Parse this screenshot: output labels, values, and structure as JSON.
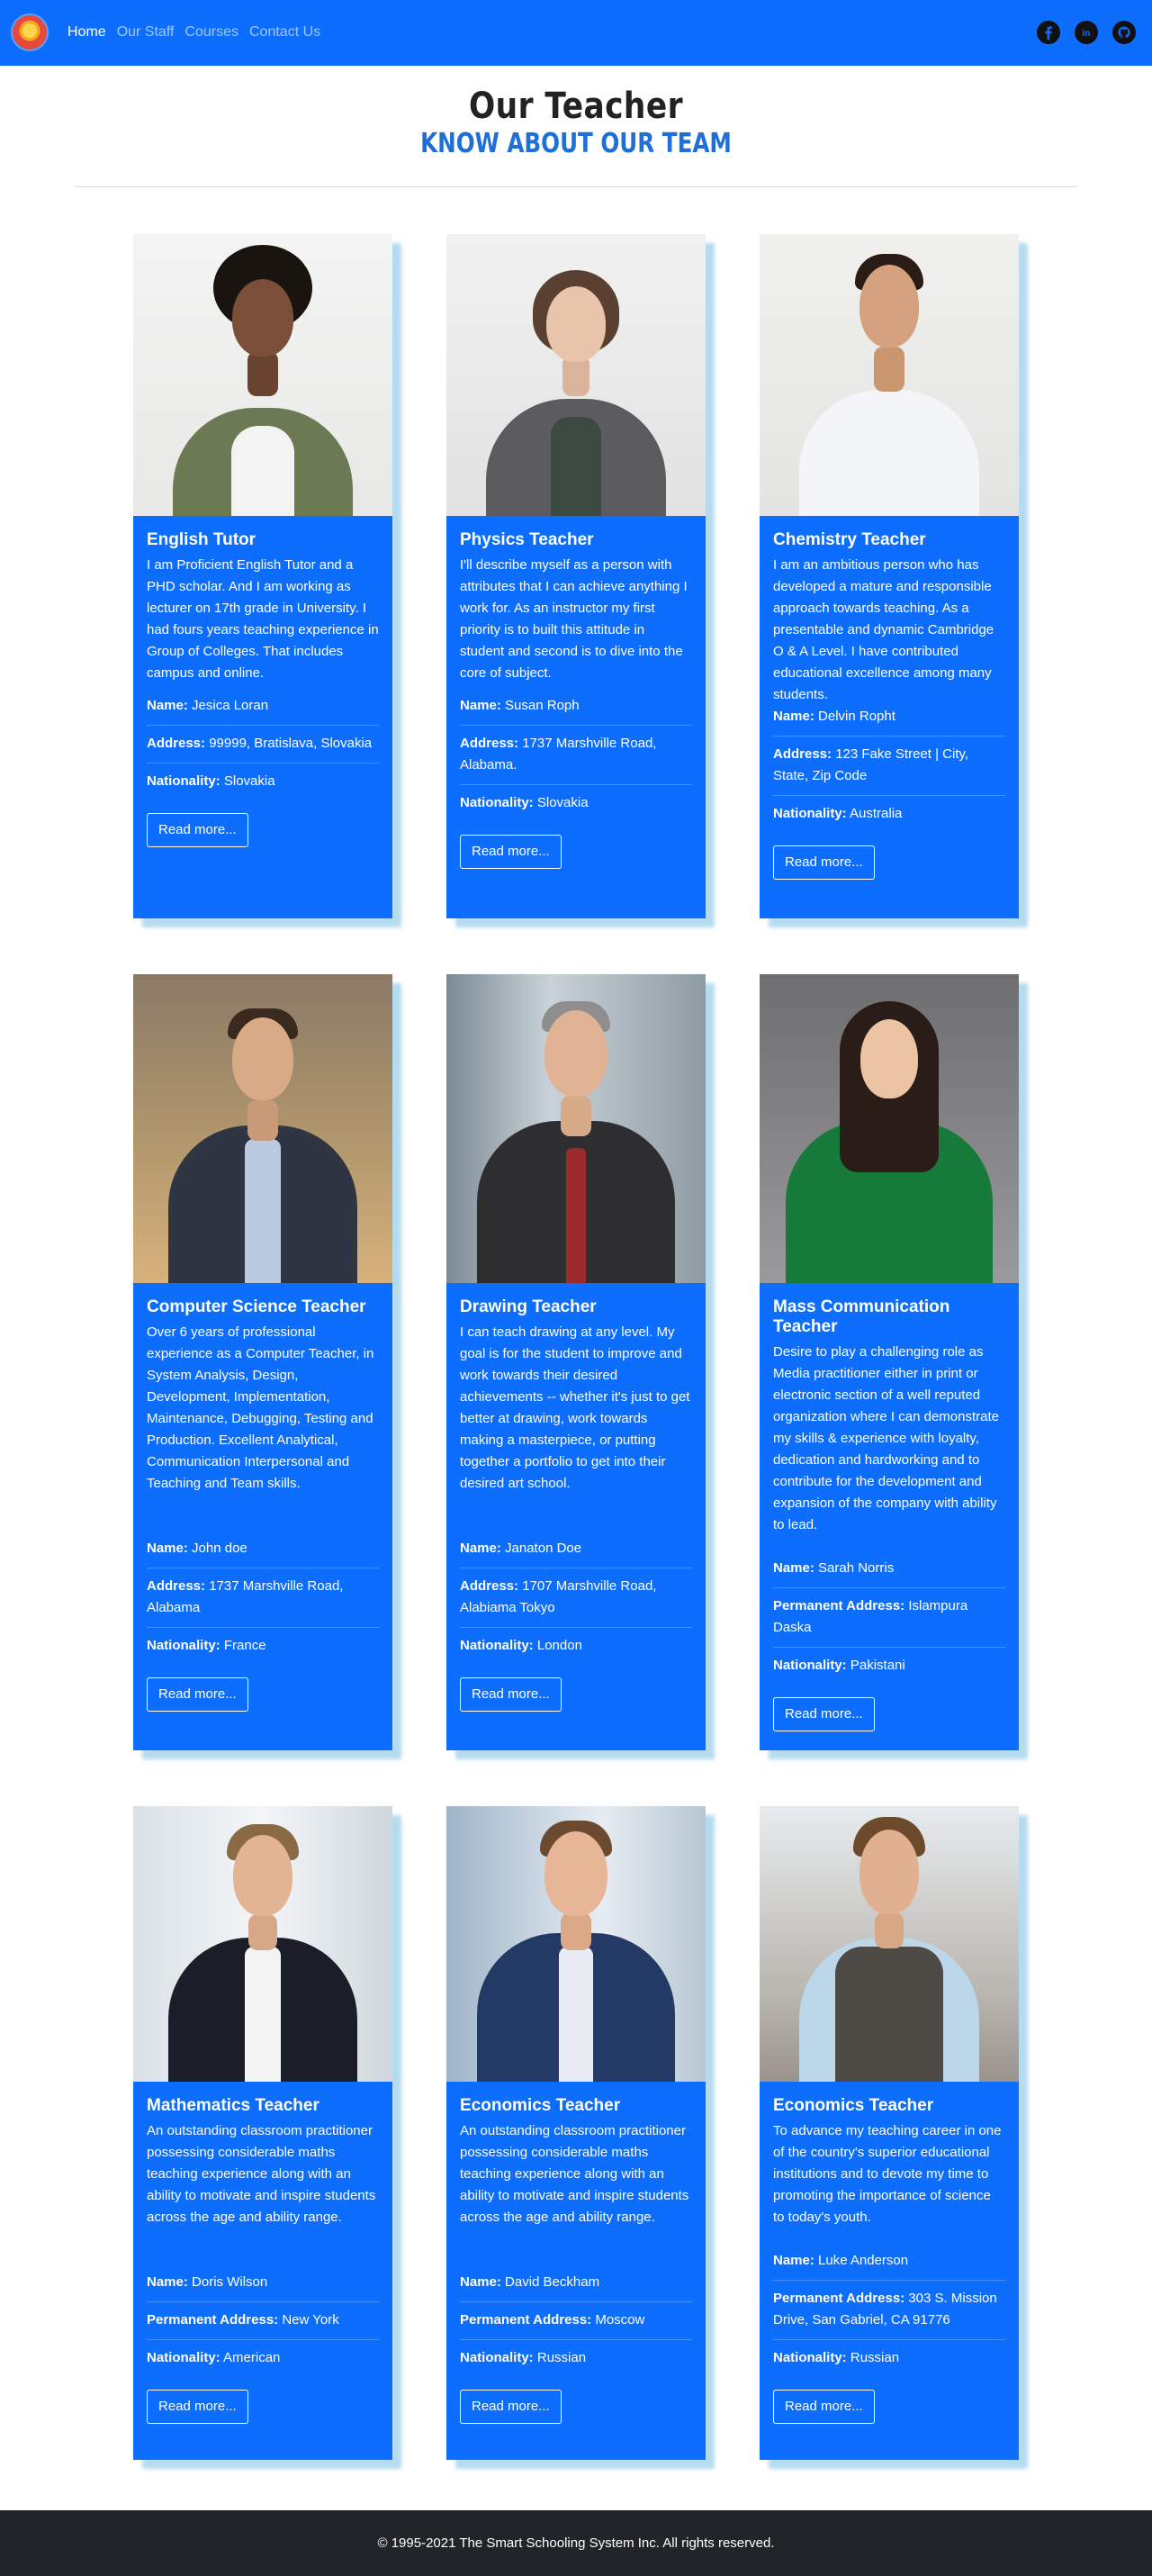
{
  "nav": {
    "links": [
      {
        "label": "Home",
        "active": true
      },
      {
        "label": "Our Staff"
      },
      {
        "label": "Courses"
      },
      {
        "label": "Contact Us"
      }
    ],
    "social_icons": [
      "facebook-icon",
      "linkedin-icon",
      "github-icon"
    ]
  },
  "heading": {
    "title": "Our Teacher",
    "subtitle": "KNOW ABOUT OUR TEAM"
  },
  "colors": {
    "primary": "#0d6efd",
    "subtitle": "#1f6fd6",
    "footer_bg": "#212529",
    "card_shadow": "#78bee1"
  },
  "teachers": [
    {
      "title": "English Tutor",
      "text": "I am Proficient English Tutor and a PHD scholar. And I am working as lecturer on 17th grade in University. I had fours years teaching experience in Group of Colleges. That includes campus and online.",
      "fields": [
        {
          "label": "Name:",
          "value": "Jesica Loran"
        },
        {
          "label": "Address:",
          "value": "99999, Bratislava, Slovakia"
        },
        {
          "label": "Nationality:",
          "value": "Slovakia"
        }
      ],
      "button": "Read more..."
    },
    {
      "title": "Physics Teacher",
      "text": "I'll describe myself as a person with attributes that I can achieve anything I work for. As an instructor my first priority is to built this attitude in student and second is to dive into the core of subject.",
      "fields": [
        {
          "label": "Name:",
          "value": "Susan Roph"
        },
        {
          "label": "Address:",
          "value": "1737 Marshville Road, Alabama."
        },
        {
          "label": "Nationality:",
          "value": "Slovakia"
        }
      ],
      "button": "Read more..."
    },
    {
      "title": "Chemistry Teacher",
      "text": "I am an ambitious person who has developed a mature and responsible approach towards teaching. As a presentable and dynamic Cambridge O & A Level. I have contributed educational excellence among many students.",
      "fields": [
        {
          "label": "Name:",
          "value": "Delvin Ropht"
        },
        {
          "label": "Address:",
          "value": "123 Fake Street | City, State, Zip Code"
        },
        {
          "label": "Nationality:",
          "value": "Australia"
        }
      ],
      "button": "Read more..."
    },
    {
      "title": "Computer Science Teacher",
      "text": "Over 6 years of professional experience as a Computer Teacher, in System Analysis, Design, Development, Implementation, Maintenance, Debugging, Testing and Production. Excellent Analytical, Communication Interpersonal and Teaching and Team skills.",
      "fields": [
        {
          "label": "Name:",
          "value": "John doe"
        },
        {
          "label": "Address:",
          "value": "1737 Marshville Road, Alabama"
        },
        {
          "label": "Nationality:",
          "value": "France"
        }
      ],
      "button": "Read more..."
    },
    {
      "title": "Drawing Teacher",
      "text": "I can teach drawing at any level. My goal is for the student to improve and work towards their desired achievements -- whether it's just to get better at drawing, work towards making a masterpiece, or putting together a portfolio to get into their desired art school.",
      "fields": [
        {
          "label": "Name:",
          "value": "Janaton Doe"
        },
        {
          "label": "Address:",
          "value": "1707 Marshville Road, Alabiama Tokyo"
        },
        {
          "label": "Nationality:",
          "value": "London"
        }
      ],
      "button": "Read more..."
    },
    {
      "title": "Mass Communication Teacher",
      "text": "Desire to play a challenging role as Media practitioner either in print or electronic section of a well reputed organization where I can demonstrate my skills & experience with loyalty, dedication and hardworking and to contribute for the development and expansion of the company with ability to lead.",
      "fields": [
        {
          "label": "Name:",
          "value": "Sarah Norris"
        },
        {
          "label": "Permanent Address:",
          "value": "Islampura Daska"
        },
        {
          "label": "Nationality:",
          "value": "Pakistani"
        }
      ],
      "button": "Read more..."
    },
    {
      "title": "Mathematics Teacher",
      "text": "An outstanding classroom practitioner possessing considerable maths teaching experience along with an ability to motivate and inspire students across the age and ability range.",
      "fields": [
        {
          "label": "Name:",
          "value": "Doris Wilson"
        },
        {
          "label": "Permanent Address:",
          "value": "New York"
        },
        {
          "label": "Nationality:",
          "value": "American"
        }
      ],
      "button": "Read more..."
    },
    {
      "title": "Economics Teacher",
      "text": "An outstanding classroom practitioner possessing considerable maths teaching experience along with an ability to motivate and inspire students across the age and ability range.",
      "fields": [
        {
          "label": "Name:",
          "value": "David Beckham"
        },
        {
          "label": "Permanent Address:",
          "value": "Moscow"
        },
        {
          "label": "Nationality:",
          "value": "Russian"
        }
      ],
      "button": "Read more..."
    },
    {
      "title": "Economics Teacher",
      "text": "To advance my teaching career in one of the country's superior educational institutions and to devote my time to promoting the importance of science to today's youth.",
      "fields": [
        {
          "label": "Name:",
          "value": "Luke Anderson"
        },
        {
          "label": "Permanent Address:",
          "value": "303 S. Mission Drive, San Gabriel, CA 91776"
        },
        {
          "label": "Nationality:",
          "value": "Russian"
        }
      ],
      "button": "Read more..."
    }
  ],
  "footer": {
    "text": "© 1995-2021 The Smart Schooling System Inc. All rights reserved."
  }
}
